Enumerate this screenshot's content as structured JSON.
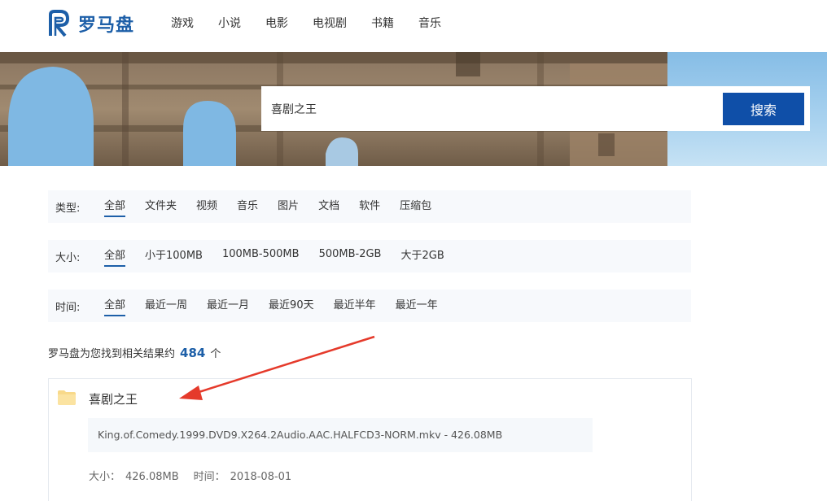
{
  "header": {
    "brand": "罗马盘",
    "nav": [
      "游戏",
      "小说",
      "电影",
      "电视剧",
      "书籍",
      "音乐"
    ]
  },
  "search": {
    "value": "喜剧之王",
    "button": "搜索"
  },
  "filters": {
    "type": {
      "label": "类型:",
      "options": [
        "全部",
        "文件夹",
        "视频",
        "音乐",
        "图片",
        "文档",
        "软件",
        "压缩包"
      ],
      "active": "全部"
    },
    "size": {
      "label": "大小:",
      "options": [
        "全部",
        "小于100MB",
        "100MB-500MB",
        "500MB-2GB",
        "大于2GB"
      ],
      "active": "全部"
    },
    "time": {
      "label": "时间:",
      "options": [
        "全部",
        "最近一周",
        "最近一月",
        "最近90天",
        "最近半年",
        "最近一年"
      ],
      "active": "全部"
    }
  },
  "summary": {
    "prefix": "罗马盘为您找到相关结果约",
    "count": "484",
    "suffix": "个"
  },
  "results": [
    {
      "title": "喜剧之王",
      "file": "King.of.Comedy.1999.DVD9.X264.2Audio.AAC.HALFCD3-NORM.mkv - 426.08MB",
      "size_label": "大小：",
      "size": "426.08MB",
      "time_label": "时间：",
      "time": "2018-08-01"
    }
  ],
  "colors": {
    "brand": "#1d5fa8",
    "button": "#0f4fa8",
    "arrow": "#e53a2b"
  },
  "icons": {
    "logo": "roman-r-logo",
    "folder": "folder-icon"
  }
}
